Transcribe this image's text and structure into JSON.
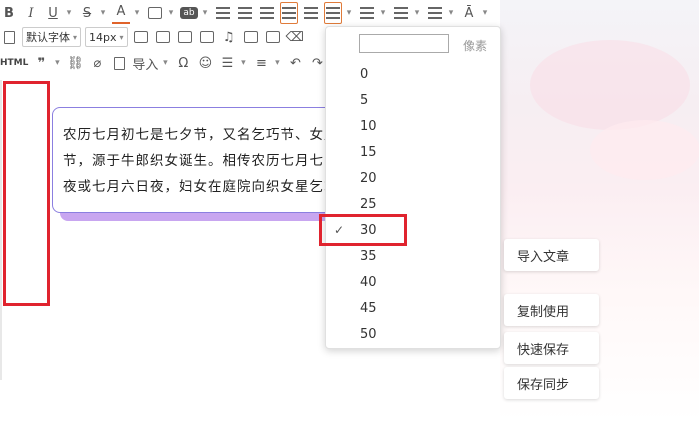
{
  "editor": {
    "font_family": "默认字体",
    "font_size": "14px",
    "html_label": "HTML",
    "import_label": "导入",
    "content": "农历七月初七是七夕节，又名乞巧节、女儿节，源于牛郎织女诞生。相传农历七月七日夜或七月六日夜，妇女在庭院向织女星乞求智巧，故称为“乞巧”。"
  },
  "dropdown": {
    "unit_label": "像素",
    "selected": "30",
    "check_mark": "✓",
    "options": [
      "0",
      "5",
      "10",
      "15",
      "20",
      "25",
      "30",
      "35",
      "40",
      "45",
      "50"
    ]
  },
  "side_buttons": {
    "import_article": "导入文章",
    "copy_use": "复制使用",
    "quick_save": "快速保存",
    "save_sync": "保存同步"
  },
  "colors": {
    "accent_red": "#e0232e",
    "card_border": "#8b7fe0",
    "font_color_underline": "#e0632a"
  }
}
